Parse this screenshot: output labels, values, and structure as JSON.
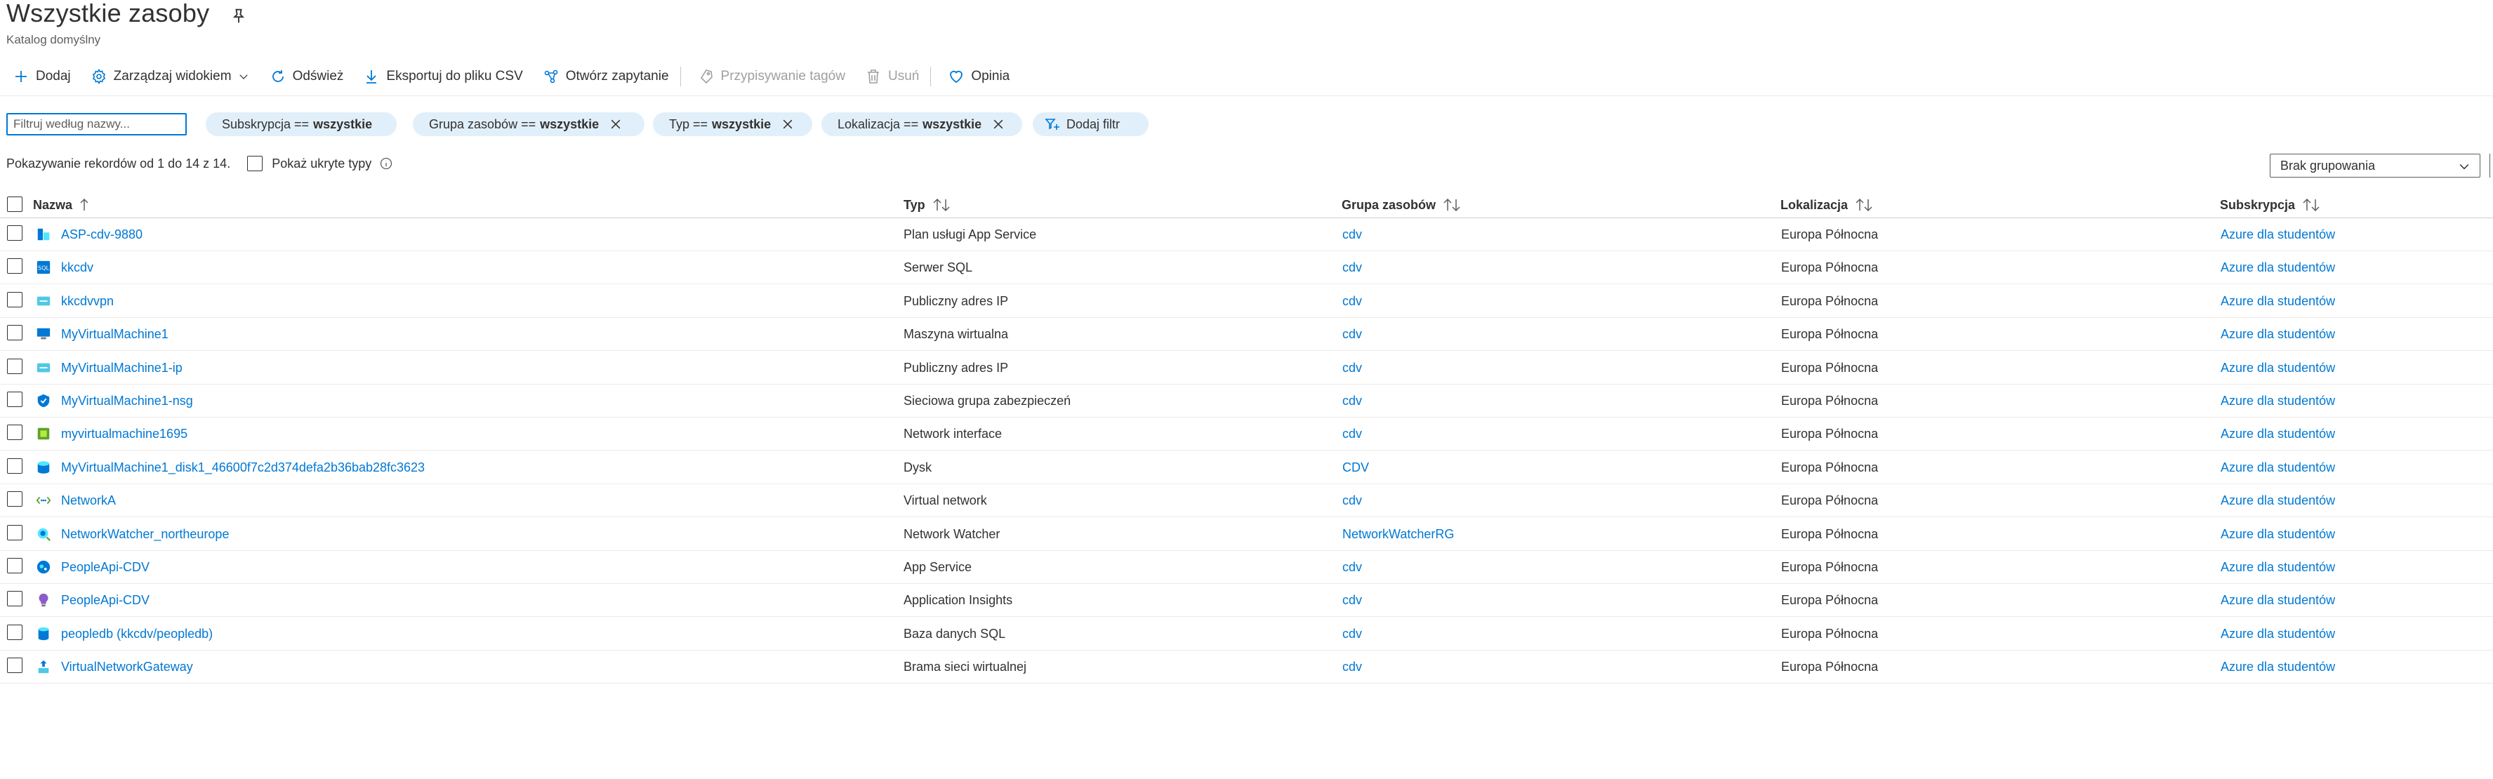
{
  "header": {
    "title": "Wszystkie zasoby",
    "subtitle": "Katalog domyślny"
  },
  "toolbar": {
    "add": "Dodaj",
    "manage_view": "Zarządzaj widokiem",
    "refresh": "Odśwież",
    "export_csv": "Eksportuj do pliku CSV",
    "open_query": "Otwórz zapytanie",
    "assign_tags": "Przypisywanie tagów",
    "delete": "Usuń",
    "feedback": "Opinia"
  },
  "filters": {
    "search_placeholder": "Filtruj według nazwy...",
    "pills": [
      {
        "label": "Subskrypcja ==",
        "value": "wszystkie"
      },
      {
        "label": "Grupa zasobów ==",
        "value": "wszystkie"
      },
      {
        "label": "Typ ==",
        "value": "wszystkie"
      },
      {
        "label": "Lokalizacja ==",
        "value": "wszystkie"
      }
    ],
    "add_filter": "Dodaj filtr"
  },
  "records": {
    "count_text": "Pokazywanie rekordów od 1 do 14 z 14.",
    "show_hidden": "Pokaż ukryte typy"
  },
  "grouping": {
    "selected": "Brak grupowania"
  },
  "table": {
    "columns": [
      "Nazwa",
      "Typ",
      "Grupa zasobów",
      "Lokalizacja",
      "Subskrypcja"
    ],
    "rows": [
      {
        "name": "ASP-cdv-9880",
        "type": "Plan usługi App Service",
        "group": "cdv",
        "location": "Europa Północna",
        "subscription": "Azure dla studentów",
        "icon": "app-service-plan-icon"
      },
      {
        "name": "kkcdv",
        "type": "Serwer SQL",
        "group": "cdv",
        "location": "Europa Północna",
        "subscription": "Azure dla studentów",
        "icon": "sql-server-icon"
      },
      {
        "name": "kkcdvvpn",
        "type": "Publiczny adres IP",
        "group": "cdv",
        "location": "Europa Północna",
        "subscription": "Azure dla studentów",
        "icon": "public-ip-icon"
      },
      {
        "name": "MyVirtualMachine1",
        "type": "Maszyna wirtualna",
        "group": "cdv",
        "location": "Europa Północna",
        "subscription": "Azure dla studentów",
        "icon": "virtual-machine-icon"
      },
      {
        "name": "MyVirtualMachine1-ip",
        "type": "Publiczny adres IP",
        "group": "cdv",
        "location": "Europa Północna",
        "subscription": "Azure dla studentów",
        "icon": "public-ip-icon"
      },
      {
        "name": "MyVirtualMachine1-nsg",
        "type": "Sieciowa grupa zabezpieczeń",
        "group": "cdv",
        "location": "Europa Północna",
        "subscription": "Azure dla studentów",
        "icon": "network-security-group-icon"
      },
      {
        "name": "myvirtualmachine1695",
        "type": "Network interface",
        "group": "cdv",
        "location": "Europa Północna",
        "subscription": "Azure dla studentów",
        "icon": "network-interface-icon"
      },
      {
        "name": "MyVirtualMachine1_disk1_46600f7c2d374defa2b36bab28fc3623",
        "type": "Dysk",
        "group": "CDV",
        "location": "Europa Północna",
        "subscription": "Azure dla studentów",
        "icon": "disk-icon"
      },
      {
        "name": "NetworkA",
        "type": "Virtual network",
        "group": "cdv",
        "location": "Europa Północna",
        "subscription": "Azure dla studentów",
        "icon": "virtual-network-icon"
      },
      {
        "name": "NetworkWatcher_northeurope",
        "type": "Network Watcher",
        "group": "NetworkWatcherRG",
        "location": "Europa Północna",
        "subscription": "Azure dla studentów",
        "icon": "network-watcher-icon"
      },
      {
        "name": "PeopleApi-CDV",
        "type": "App Service",
        "group": "cdv",
        "location": "Europa Północna",
        "subscription": "Azure dla studentów",
        "icon": "app-service-icon"
      },
      {
        "name": "PeopleApi-CDV",
        "type": "Application Insights",
        "group": "cdv",
        "location": "Europa Północna",
        "subscription": "Azure dla studentów",
        "icon": "application-insights-icon"
      },
      {
        "name": "peopledb (kkcdv/peopledb)",
        "type": "Baza danych SQL",
        "group": "cdv",
        "location": "Europa Północna",
        "subscription": "Azure dla studentów",
        "icon": "sql-database-icon"
      },
      {
        "name": "VirtualNetworkGateway",
        "type": "Brama sieci wirtualnej",
        "group": "cdv",
        "location": "Europa Północna",
        "subscription": "Azure dla studentów",
        "icon": "virtual-network-gateway-icon"
      }
    ]
  },
  "colors": {
    "link": "#0078d4",
    "accent": "#0078d4",
    "pill_bg": "#e1effa",
    "text": "#323130",
    "muted": "#605e5c"
  }
}
